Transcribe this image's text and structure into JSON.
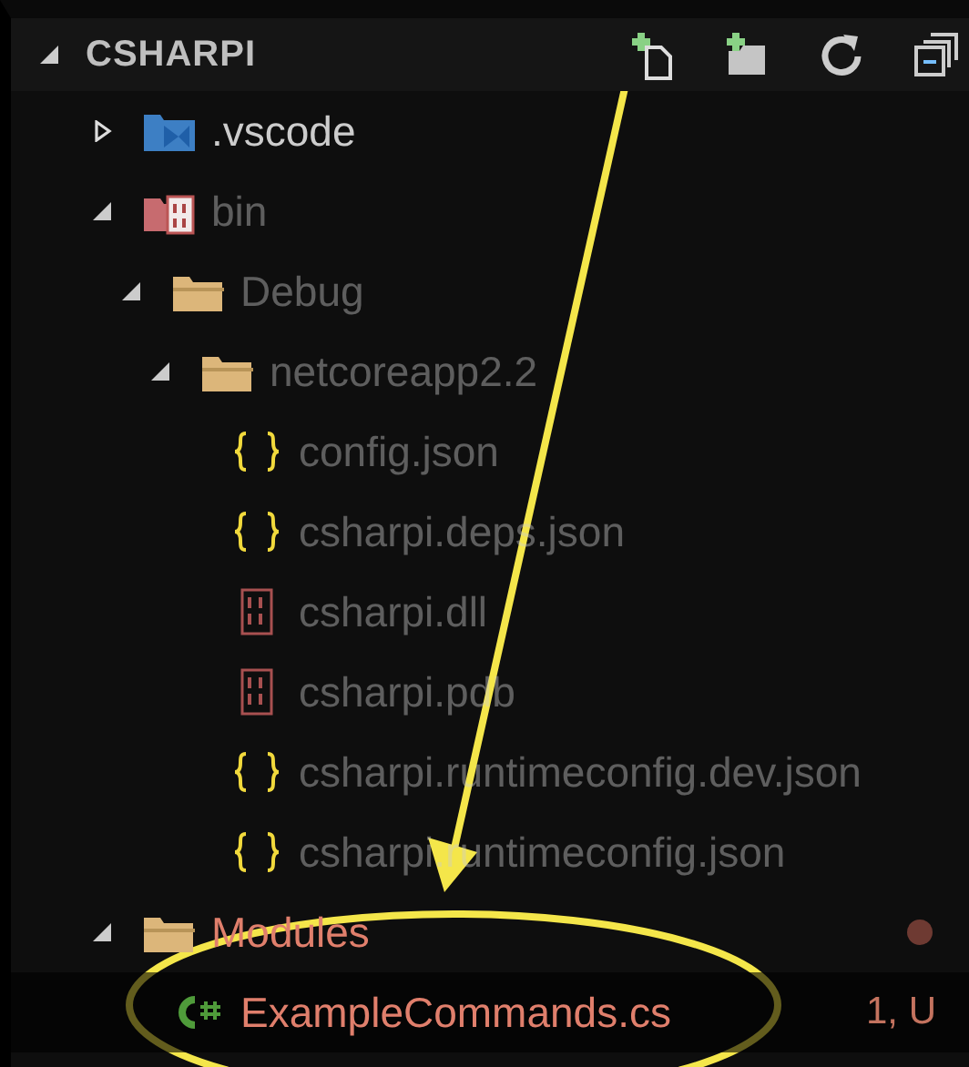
{
  "section": {
    "title": "CSHARPI",
    "expanded": true
  },
  "tree": [
    {
      "label": ".vscode",
      "kind": "vscode",
      "expanded": false,
      "dimmed": false,
      "untracked": false,
      "selected": false
    },
    {
      "label": "bin",
      "kind": "binfolder",
      "expanded": true,
      "dimmed": true,
      "untracked": false,
      "selected": false,
      "children": [
        {
          "label": "Debug",
          "kind": "folder",
          "expanded": true,
          "dimmed": true,
          "untracked": false,
          "selected": false,
          "children": [
            {
              "label": "netcoreapp2.2",
              "kind": "folder",
              "expanded": true,
              "dimmed": true,
              "untracked": false,
              "selected": false,
              "children": [
                {
                  "label": "config.json",
                  "kind": "json",
                  "dimmed": true,
                  "untracked": false,
                  "selected": false
                },
                {
                  "label": "csharpi.deps.json",
                  "kind": "json",
                  "dimmed": true,
                  "untracked": false,
                  "selected": false
                },
                {
                  "label": "csharpi.dll",
                  "kind": "binary",
                  "dimmed": true,
                  "untracked": false,
                  "selected": false
                },
                {
                  "label": "csharpi.pdb",
                  "kind": "binary",
                  "dimmed": true,
                  "untracked": false,
                  "selected": false
                },
                {
                  "label": "csharpi.runtimeconfig.dev.json",
                  "kind": "json",
                  "dimmed": true,
                  "untracked": false,
                  "selected": false
                },
                {
                  "label": "csharpi.runtimeconfig.json",
                  "kind": "json",
                  "dimmed": true,
                  "untracked": false,
                  "selected": false
                }
              ]
            }
          ]
        }
      ]
    },
    {
      "label": "Modules",
      "kind": "folder",
      "expanded": true,
      "dimmed": false,
      "untracked": true,
      "selected": false,
      "dot": true,
      "children": [
        {
          "label": "ExampleCommands.cs",
          "kind": "csharp",
          "dimmed": false,
          "untracked": true,
          "selected": true,
          "badge": "1, U"
        }
      ]
    }
  ]
}
